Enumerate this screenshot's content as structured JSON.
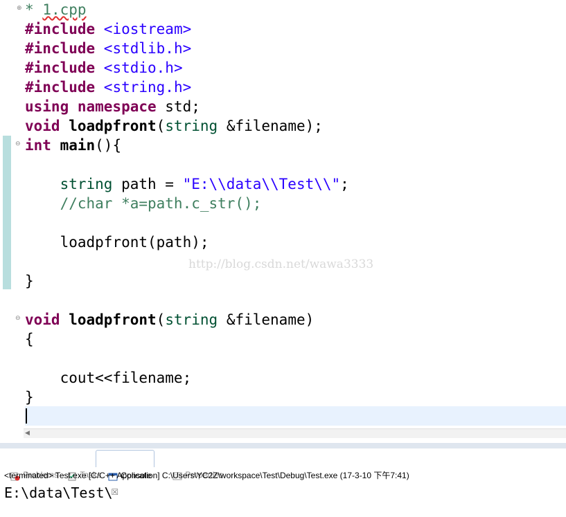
{
  "editor": {
    "tab_marker": "*",
    "tab_name": "1.cpp",
    "lines": {
      "l1_kw": "#include",
      "l1_rest": " <iostream>",
      "l2_kw": "#include",
      "l2_rest": " <stdlib.h>",
      "l3_kw": "#include",
      "l3_rest": " <stdio.h>",
      "l4_kw": "#include",
      "l4_rest": " <string.h>",
      "l5_kw1": "using",
      "l5_kw2": " namespace",
      "l5_rest": " std;",
      "l6_kw": "void",
      "l6_fn": " loadpfront",
      "l6_p1": "(",
      "l6_type": "string",
      "l6_rest": " &filename);",
      "l7_kw": "int",
      "l7_fn": " main",
      "l7_rest": "(){",
      "l9_type": "    string",
      "l9_mid": " path = ",
      "l9_str": "\"E:\\\\data\\\\Test\\\\\"",
      "l9_end": ";",
      "l10_cmt": "    //char *a=path.c_str();",
      "l12": "    loadpfront(path);",
      "l14": "}",
      "l16_kw": "void",
      "l16_fn": " loadpfront",
      "l16_p1": "(",
      "l16_type": "string",
      "l16_rest": " &filename)",
      "l17": "{",
      "l19": "    cout<<filename;",
      "l20": "}"
    },
    "watermark": "http://blog.csdn.net/wawa3333"
  },
  "views": {
    "tabs": [
      "Problems",
      "Tasks",
      "Console",
      "Properties"
    ],
    "console_close": "☒"
  },
  "console": {
    "info": "<terminated> Test.exe [C/C++ Application] C:\\Users\\YC2Z\\workspace\\Test\\Debug\\Test.exe (17-3-10 下午7:41)",
    "output": "E:\\data\\Test\\"
  }
}
